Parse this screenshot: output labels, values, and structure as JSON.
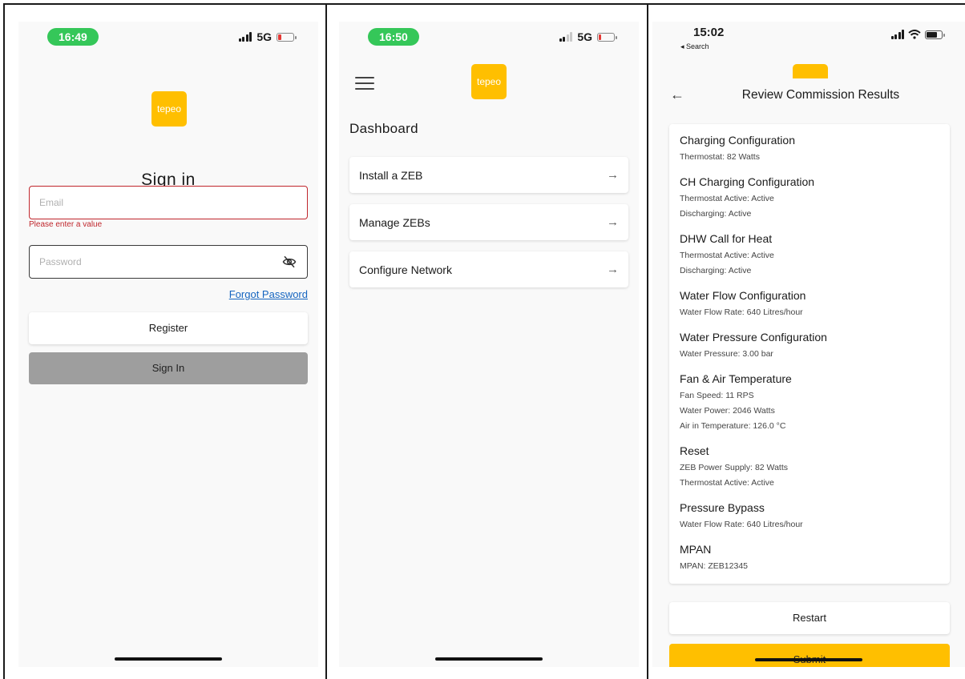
{
  "signin": {
    "status_time": "16:49",
    "network": "5G",
    "logo": "tepeo",
    "title": "Sign in",
    "email_placeholder": "Email",
    "email_error": "Please enter a value",
    "password_placeholder": "Password",
    "forgot_password": "Forgot Password",
    "register_button": "Register",
    "signin_button": "Sign In"
  },
  "dashboard": {
    "status_time": "16:50",
    "network": "5G",
    "logo": "tepeo",
    "title": "Dashboard",
    "items": [
      {
        "label": "Install a ZEB",
        "arrow": "→"
      },
      {
        "label": "Manage ZEBs",
        "arrow": "→"
      },
      {
        "label": "Configure Network",
        "arrow": "→"
      }
    ]
  },
  "review": {
    "status_time": "15:02",
    "back_app": "◂ Search",
    "back_arrow": "←",
    "title": "Review Commission Results",
    "sections": [
      {
        "title": "Charging Configuration",
        "lines": [
          "Thermostat: 82 Watts"
        ]
      },
      {
        "title": "CH Charging Configuration",
        "lines": [
          "Thermostat Active: Active",
          "Discharging: Active"
        ]
      },
      {
        "title": "DHW Call for Heat",
        "lines": [
          "Thermostat Active: Active",
          "Discharging: Active"
        ]
      },
      {
        "title": "Water Flow Configuration",
        "lines": [
          "Water Flow Rate: 640 Litres/hour"
        ]
      },
      {
        "title": "Water Pressure Configuration",
        "lines": [
          "Water Pressure: 3.00 bar"
        ]
      },
      {
        "title": "Fan & Air Temperature",
        "lines": [
          "Fan Speed: 11 RPS",
          "Water Power: 2046 Watts",
          "Air in Temperature: 126.0 °C"
        ]
      },
      {
        "title": "Reset",
        "lines": [
          "ZEB Power Supply: 82 Watts",
          "Thermostat Active: Active"
        ]
      },
      {
        "title": "Pressure Bypass",
        "lines": [
          "Water Flow Rate: 640 Litres/hour"
        ]
      },
      {
        "title": "MPAN",
        "lines": [
          "MPAN: ZEB12345"
        ]
      }
    ],
    "restart_button": "Restart",
    "submit_button": "Submit"
  },
  "colors": {
    "brand_yellow": "#ffbf00",
    "status_green": "#35c759",
    "error_red": "#c0272d",
    "link_blue": "#1565c0"
  }
}
